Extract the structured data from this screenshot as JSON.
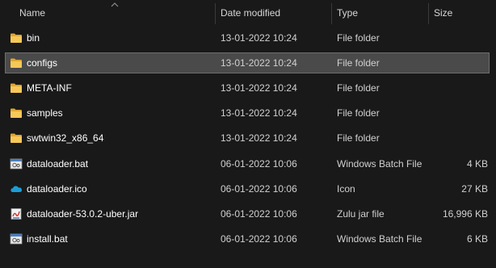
{
  "columns": {
    "name": "Name",
    "date_modified": "Date modified",
    "type": "Type",
    "size": "Size"
  },
  "sort": {
    "column": "Name",
    "direction": "ascending",
    "icon": "chevron-up-icon"
  },
  "colors": {
    "background": "#191919",
    "selected_row": "#4a4a4a",
    "folder": "#f3c04f"
  },
  "files": [
    {
      "name": "bin",
      "date": "13-01-2022 10:24",
      "type": "File folder",
      "size": "",
      "icon": "folder-icon",
      "selected": false
    },
    {
      "name": "configs",
      "date": "13-01-2022 10:24",
      "type": "File folder",
      "size": "",
      "icon": "folder-icon",
      "selected": true
    },
    {
      "name": "META-INF",
      "date": "13-01-2022 10:24",
      "type": "File folder",
      "size": "",
      "icon": "folder-icon",
      "selected": false
    },
    {
      "name": "samples",
      "date": "13-01-2022 10:24",
      "type": "File folder",
      "size": "",
      "icon": "folder-icon",
      "selected": false
    },
    {
      "name": "swtwin32_x86_64",
      "date": "13-01-2022 10:24",
      "type": "File folder",
      "size": "",
      "icon": "folder-icon",
      "selected": false
    },
    {
      "name": "dataloader.bat",
      "date": "06-01-2022 10:06",
      "type": "Windows Batch File",
      "size": "4 KB",
      "icon": "batch-file-icon",
      "selected": false
    },
    {
      "name": "dataloader.ico",
      "date": "06-01-2022 10:06",
      "type": "Icon",
      "size": "27 KB",
      "icon": "cloud-icon",
      "selected": false
    },
    {
      "name": "dataloader-53.0.2-uber.jar",
      "date": "06-01-2022 10:06",
      "type": "Zulu jar file",
      "size": "16,996 KB",
      "icon": "jar-file-icon",
      "selected": false
    },
    {
      "name": "install.bat",
      "date": "06-01-2022 10:06",
      "type": "Windows Batch File",
      "size": "6 KB",
      "icon": "batch-file-icon",
      "selected": false
    }
  ]
}
